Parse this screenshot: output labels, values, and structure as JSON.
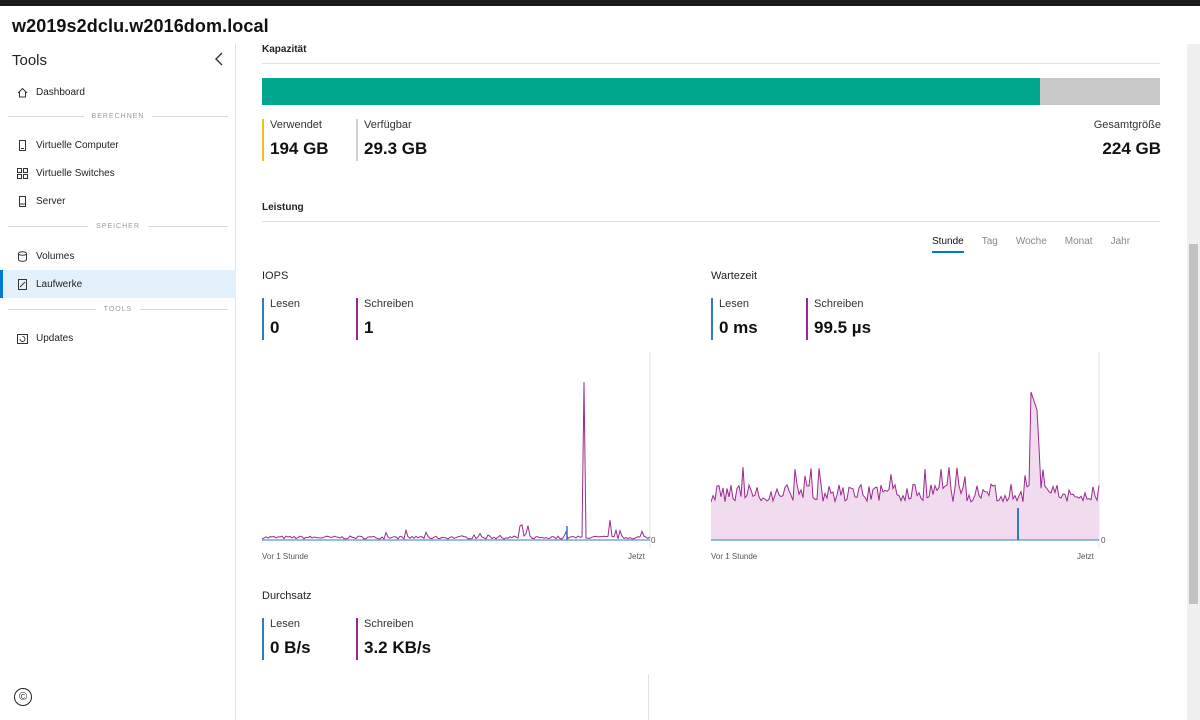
{
  "window": {
    "title": "w2019s2dclu.w2016dom.local"
  },
  "sidebar": {
    "header": "Tools",
    "items": [
      {
        "label": "Dashboard"
      },
      {
        "section": "BERECHNEN"
      },
      {
        "label": "Virtuelle Computer"
      },
      {
        "label": "Virtuelle Switches"
      },
      {
        "label": "Server"
      },
      {
        "section": "SPEICHER"
      },
      {
        "label": "Volumes"
      },
      {
        "label": "Laufwerke",
        "active": true
      },
      {
        "section": "TOOLS"
      },
      {
        "label": "Updates"
      }
    ],
    "labels": {
      "dashboard": "Dashboard",
      "section_compute": "BERECHNEN",
      "vms": "Virtuelle Computer",
      "switches": "Virtuelle Switches",
      "server": "Server",
      "section_storage": "SPEICHER",
      "volumes": "Volumes",
      "drives": "Laufwerke",
      "section_tools": "TOOLS",
      "updates": "Updates"
    },
    "copyright": "©"
  },
  "capacity": {
    "title": "Kapazität",
    "used_fraction": 0.866,
    "used_label": "Verwendet",
    "used_value": "194 GB",
    "available_label": "Verfügbar",
    "available_value": "29.3 GB",
    "total_label": "Gesamtgröße",
    "total_value": "224 GB",
    "colors": {
      "used": "#00a78c",
      "free": "#c8c8c8"
    }
  },
  "performance": {
    "title": "Leistung",
    "ranges": [
      "Stunde",
      "Tag",
      "Woche",
      "Monat",
      "Jahr"
    ],
    "active_range": "Stunde",
    "iops": {
      "title": "IOPS",
      "read_label": "Lesen",
      "read_value": "0",
      "write_label": "Schreiben",
      "write_value": "1",
      "x_start": "Vor 1 Stunde",
      "x_end": "Jetzt",
      "y_zero": "0"
    },
    "latency": {
      "title": "Wartezeit",
      "read_label": "Lesen",
      "read_value": "0 ms",
      "write_label": "Schreiben",
      "write_value": "99.5 µs",
      "x_start": "Vor 1 Stunde",
      "x_end": "Jetzt",
      "y_zero": "0"
    },
    "throughput": {
      "title": "Durchsatz",
      "read_label": "Lesen",
      "read_value": "0 B/s",
      "write_label": "Schreiben",
      "write_value": "3.2 KB/s"
    },
    "colors": {
      "read": "#2e7bc7",
      "write": "#9b2a8f",
      "write_fill": "#f1dcef"
    }
  }
}
